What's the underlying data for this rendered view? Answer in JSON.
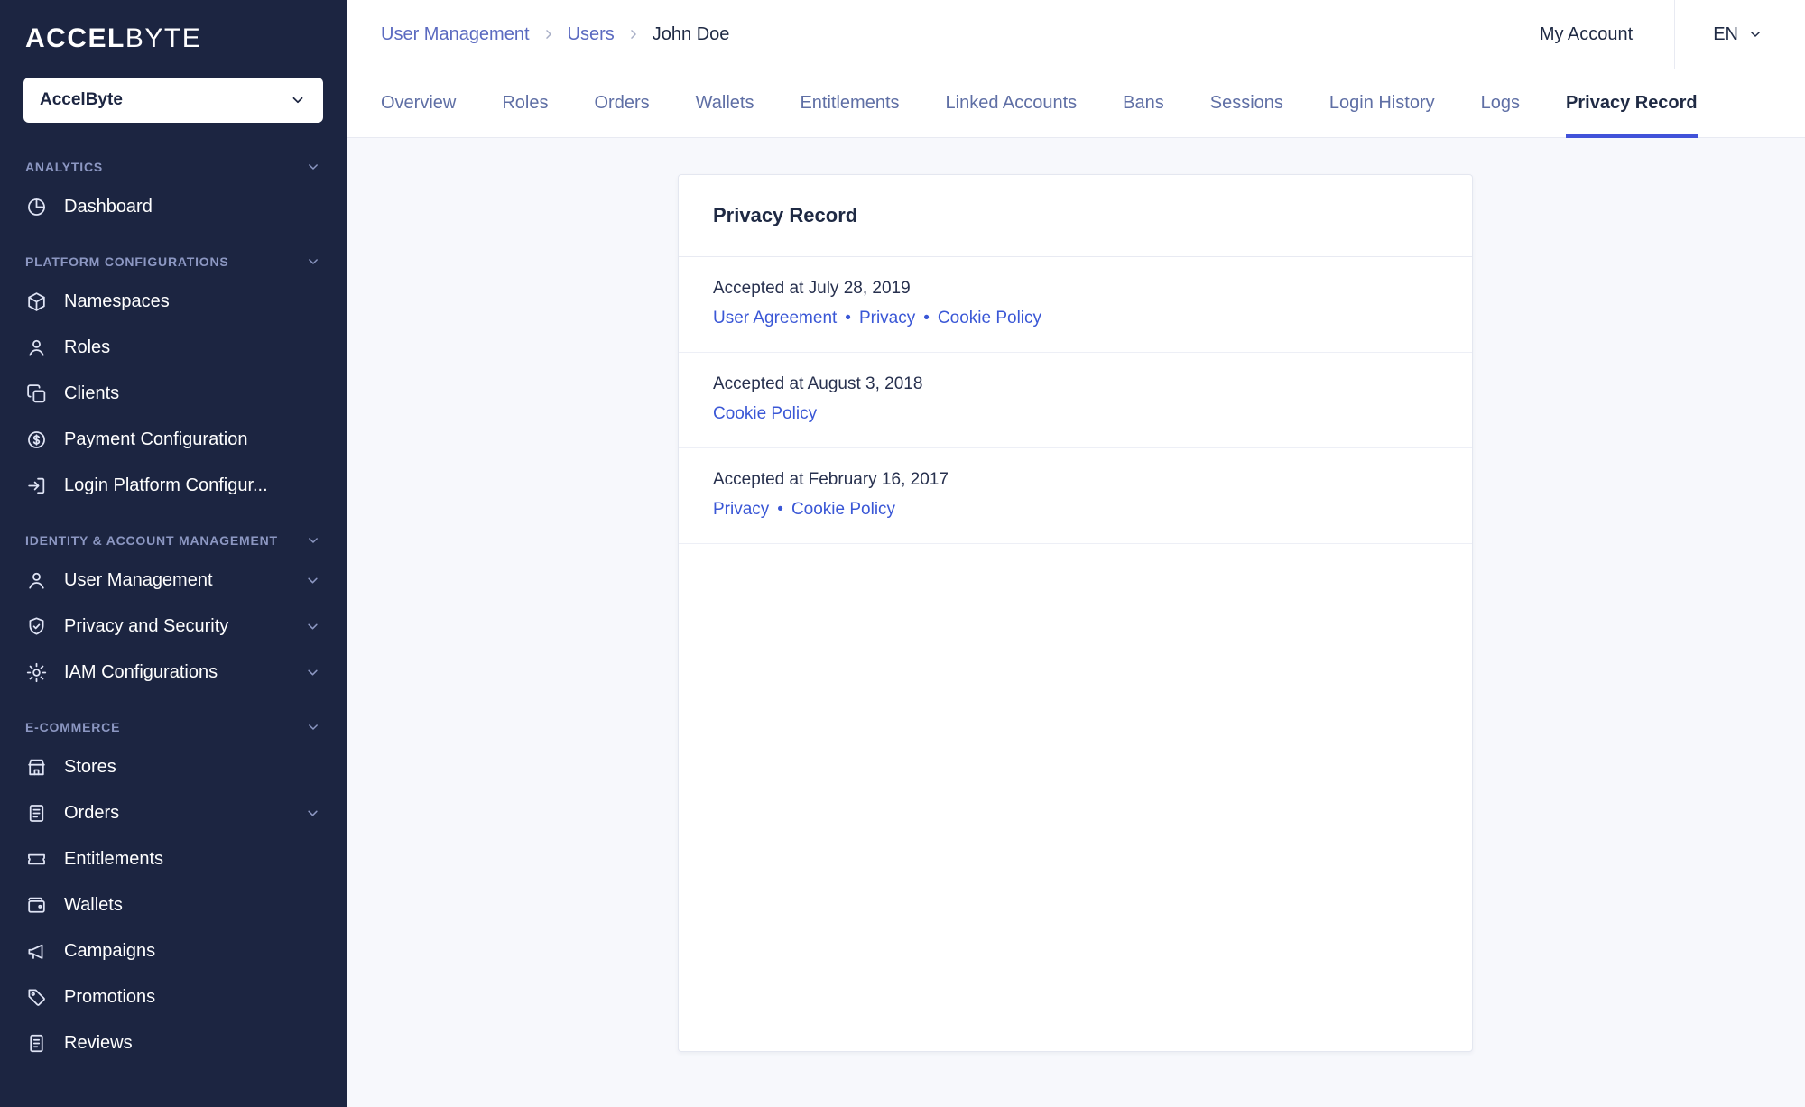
{
  "brand": {
    "accel": "ACCEL",
    "byte": "BYTE"
  },
  "namespace_selector": {
    "value": "AccelByte"
  },
  "sidebar": {
    "sections": [
      {
        "label": "ANALYTICS",
        "items": [
          {
            "label": "Dashboard"
          }
        ]
      },
      {
        "label": "PLATFORM CONFIGURATIONS",
        "items": [
          {
            "label": "Namespaces"
          },
          {
            "label": "Roles"
          },
          {
            "label": "Clients"
          },
          {
            "label": "Payment Configuration"
          },
          {
            "label": "Login Platform Configur..."
          }
        ]
      },
      {
        "label": "IDENTITY & ACCOUNT MANAGEMENT",
        "items": [
          {
            "label": "User Management"
          },
          {
            "label": "Privacy and Security"
          },
          {
            "label": "IAM Configurations"
          }
        ]
      },
      {
        "label": "E-COMMERCE",
        "items": [
          {
            "label": "Stores"
          },
          {
            "label": "Orders"
          },
          {
            "label": "Entitlements"
          },
          {
            "label": "Wallets"
          },
          {
            "label": "Campaigns"
          },
          {
            "label": "Promotions"
          },
          {
            "label": "Reviews"
          }
        ]
      }
    ]
  },
  "header": {
    "breadcrumb": [
      "User Management",
      "Users",
      "John Doe"
    ],
    "my_account": "My Account",
    "language": "EN"
  },
  "tabs": [
    "Overview",
    "Roles",
    "Orders",
    "Wallets",
    "Entitlements",
    "Linked Accounts",
    "Bans",
    "Sessions",
    "Login History",
    "Logs",
    "Privacy Record"
  ],
  "active_tab": "Privacy Record",
  "card": {
    "title": "Privacy Record",
    "link_separator": "•",
    "records": [
      {
        "prefix": "Accepted at",
        "date": "July 28, 2019",
        "links": [
          "User Agreement",
          "Privacy",
          "Cookie Policy"
        ]
      },
      {
        "prefix": "Accepted at",
        "date": "August 3, 2018",
        "links": [
          "Cookie Policy"
        ]
      },
      {
        "prefix": "Accepted at",
        "date": "February 16, 2017",
        "links": [
          "Privacy",
          "Cookie Policy"
        ]
      }
    ]
  },
  "colors": {
    "sidebar_bg": "#1c2541",
    "accent": "#4152d9",
    "link": "#3a57d6",
    "tab_inactive": "#5f6fa5",
    "text_dark": "#1f2a44"
  }
}
